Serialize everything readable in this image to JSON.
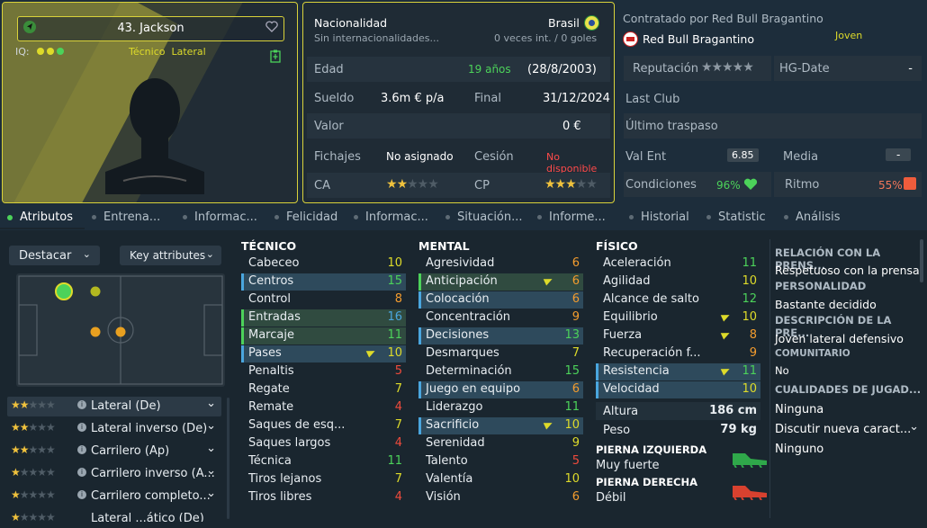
{
  "player": {
    "name": "43. Jackson",
    "iq_label": "IQ:",
    "position": "Técnico  Lateral"
  },
  "info": {
    "nationality_label": "Nacionalidad",
    "nationality": "Brasil",
    "intl_label": "Sin internacionalidades...",
    "intl_value": "0 veces int. / 0 goles",
    "age_label": "Edad",
    "age_value": "19 años",
    "age_date": "(28/8/2003)",
    "wage_label": "Sueldo",
    "wage_value": "3.6m € p/a",
    "end_label": "Final",
    "end_value": "31/12/2024",
    "value_label": "Valor",
    "value_value": "0 €",
    "transfers_label": "Fichajes",
    "transfers_value": "No asignado",
    "loan_label": "Cesión",
    "loan_value": "No disponible",
    "ca_label": "CA",
    "cp_label": "CP",
    "ca_stars": 1.5,
    "cp_stars": 2.5
  },
  "contract": {
    "contracted_by": "Contratado por Red Bull Bragantino",
    "club": "Red Bull Bragantino",
    "squad_status": "Joven",
    "reputation_label": "Reputación",
    "hg_label": "HG-Date",
    "hg_value": "-",
    "last_club_label": "Last Club",
    "last_transfer_label": "Último traspaso",
    "val_ent_label": "Val Ent",
    "val_ent_value": "6.85",
    "media_label": "Media",
    "media_value": "-",
    "cond_label": "Condiciones",
    "cond_value": "96%",
    "ritmo_label": "Ritmo",
    "ritmo_value": "55%"
  },
  "tabs": [
    "Atributos",
    "Entrena...",
    "Informac...",
    "Felicidad",
    "Informac...",
    "Situación...",
    "Informe...",
    "Historial",
    "Statistic",
    "Análisis"
  ],
  "left": {
    "highlight_label": "Destacar",
    "key_attr_label": "Key attributes",
    "roles": [
      {
        "name": "Lateral (De)",
        "stars": 1.5
      },
      {
        "name": "Lateral inverso (De)",
        "stars": 1.5
      },
      {
        "name": "Carrilero (Ap)",
        "stars": 1.5
      },
      {
        "name": "Carrilero inverso (A...",
        "stars": 1
      },
      {
        "name": "Carrilero completo...",
        "stars": 1
      },
      {
        "name": "Lateral ...ático (De)",
        "stars": 1
      }
    ]
  },
  "technical": {
    "title": "TÉCNICO",
    "attrs": [
      {
        "name": "Cabeceo",
        "value": "10"
      },
      {
        "name": "Centros",
        "value": "15"
      },
      {
        "name": "Control",
        "value": "8"
      },
      {
        "name": "Entradas",
        "value": "16"
      },
      {
        "name": "Marcaje",
        "value": "11"
      },
      {
        "name": "Pases",
        "value": "10"
      },
      {
        "name": "Penaltis",
        "value": "5"
      },
      {
        "name": "Regate",
        "value": "7"
      },
      {
        "name": "Remate",
        "value": "4"
      },
      {
        "name": "Saques de esq...",
        "value": "7"
      },
      {
        "name": "Saques largos",
        "value": "4"
      },
      {
        "name": "Técnica",
        "value": "11"
      },
      {
        "name": "Tiros lejanos",
        "value": "7"
      },
      {
        "name": "Tiros libres",
        "value": "4"
      }
    ]
  },
  "mental": {
    "title": "MENTAL",
    "attrs": [
      {
        "name": "Agresividad",
        "value": "6"
      },
      {
        "name": "Anticipación",
        "value": "6"
      },
      {
        "name": "Colocación",
        "value": "6"
      },
      {
        "name": "Concentración",
        "value": "9"
      },
      {
        "name": "Decisiones",
        "value": "13"
      },
      {
        "name": "Desmarques",
        "value": "7"
      },
      {
        "name": "Determinación",
        "value": "15"
      },
      {
        "name": "Juego en equipo",
        "value": "6"
      },
      {
        "name": "Liderazgo",
        "value": "11"
      },
      {
        "name": "Sacrificio",
        "value": "10"
      },
      {
        "name": "Serenidad",
        "value": "9"
      },
      {
        "name": "Talento",
        "value": "5"
      },
      {
        "name": "Valentía",
        "value": "10"
      },
      {
        "name": "Visión",
        "value": "6"
      }
    ]
  },
  "physical": {
    "title": "FÍSICO",
    "attrs": [
      {
        "name": "Aceleración",
        "value": "11"
      },
      {
        "name": "Agilidad",
        "value": "10"
      },
      {
        "name": "Alcance de salto",
        "value": "12"
      },
      {
        "name": "Equilibrio",
        "value": "10"
      },
      {
        "name": "Fuerza",
        "value": "8"
      },
      {
        "name": "Recuperación f...",
        "value": "9"
      },
      {
        "name": "Resistencia",
        "value": "11"
      },
      {
        "name": "Velocidad",
        "value": "10"
      }
    ],
    "height_label": "Altura",
    "height_value": "186 cm",
    "weight_label": "Peso",
    "weight_value": "79 kg",
    "left_foot_label": "PIERNA IZQUIERDA",
    "left_foot_value": "Muy fuerte",
    "right_foot_label": "PIERNA DERECHA",
    "right_foot_value": "Débil"
  },
  "side": {
    "press_title": "RELACIÓN CON LA PRENS...",
    "press_value": "Respetuoso con la prensa",
    "personality_title": "PERSONALIDAD",
    "personality_value": "Bastante decidido",
    "role_desc_title": "DESCRIPCIÓN DE LA PRE...",
    "role_desc_value": "Joven lateral defensivo",
    "community_title": "COMUNITARIO",
    "community_value": "No",
    "qualities_title": "CUALIDADES DE JUGAD...",
    "qualities_value": "Ninguna",
    "discuss_label": "Discutir nueva caract...",
    "discuss_value": "Ninguno"
  }
}
